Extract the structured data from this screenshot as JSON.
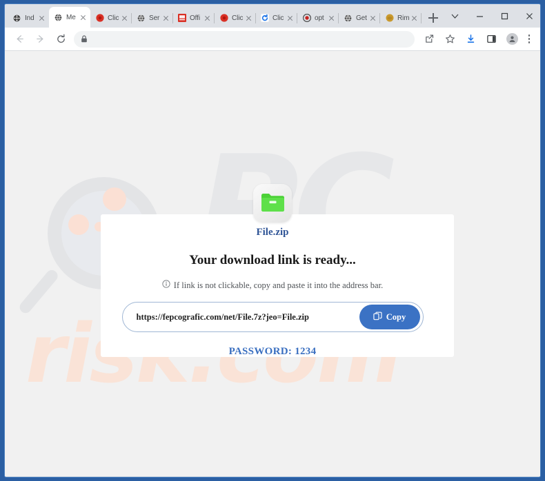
{
  "browser": {
    "tabs": [
      {
        "label": "Ind",
        "favicon": "film-reel-icon",
        "color": "#3c3c3c",
        "shape": "circle",
        "active": false
      },
      {
        "label": "Me",
        "favicon": "globe-icon",
        "color": "#3c3c3c",
        "shape": "circle",
        "active": true
      },
      {
        "label": "Clic",
        "favicon": "red-circle-icon",
        "color": "#d93025",
        "shape": "circle",
        "active": false
      },
      {
        "label": "Ser",
        "favicon": "globe-icon",
        "color": "#3c3c3c",
        "shape": "circle",
        "active": false
      },
      {
        "label": "Offi",
        "favicon": "red-document-icon",
        "color": "#d93025",
        "shape": "square",
        "active": false
      },
      {
        "label": "Clic",
        "favicon": "red-circle-icon",
        "color": "#d93025",
        "shape": "circle",
        "active": false
      },
      {
        "label": "Clic",
        "favicon": "blue-refresh-icon",
        "color": "#1a73e8",
        "shape": "square",
        "active": false
      },
      {
        "label": "opt",
        "favicon": "red-target-icon",
        "color": "#c5221f",
        "shape": "circle",
        "active": false
      },
      {
        "label": "Get",
        "favicon": "globe-icon",
        "color": "#3c3c3c",
        "shape": "circle",
        "active": false
      },
      {
        "label": "Rim",
        "favicon": "gold-circle-icon",
        "color": "#c9992e",
        "shape": "circle",
        "active": false
      }
    ],
    "new_tab_label": "New tab",
    "tab_list_label": "Search tabs",
    "window_controls": {
      "minimize": "Minimize",
      "maximize": "Maximize",
      "close": "Close"
    },
    "toolbar": {
      "back": "Back",
      "forward": "Forward",
      "reload": "Reload",
      "address_value": "",
      "address_placeholder": "",
      "lock_icon": "lock-icon",
      "share": "Share",
      "bookmark": "Bookmark this tab",
      "downloads": "Downloads",
      "side_panel": "Side panel",
      "profile": "Profile",
      "menu": "Customize and control"
    }
  },
  "page": {
    "watermark_top": "PC",
    "watermark_bottom": "risk.com",
    "file_icon": "green-archive-folder-icon",
    "file_name": "File.zip",
    "headline": "Your download link is ready...",
    "info_icon": "info-circle-icon",
    "subline": "If link is not clickable, copy and paste it into the address bar.",
    "link_url": "https://fepcografic.com/net/File.7z?jeo=File.zip",
    "copy_button_label": "Copy",
    "copy_button_icon": "copy-icon",
    "password_label": "PASSWORD: 1234",
    "colors": {
      "accent_blue": "#3b72c4",
      "file_name_blue": "#2f5496",
      "password_blue": "#3a6fc0",
      "archive_green": "#4cd137",
      "watermark_gray": "#e6e7e9",
      "watermark_peach": "#fae3d7"
    }
  }
}
